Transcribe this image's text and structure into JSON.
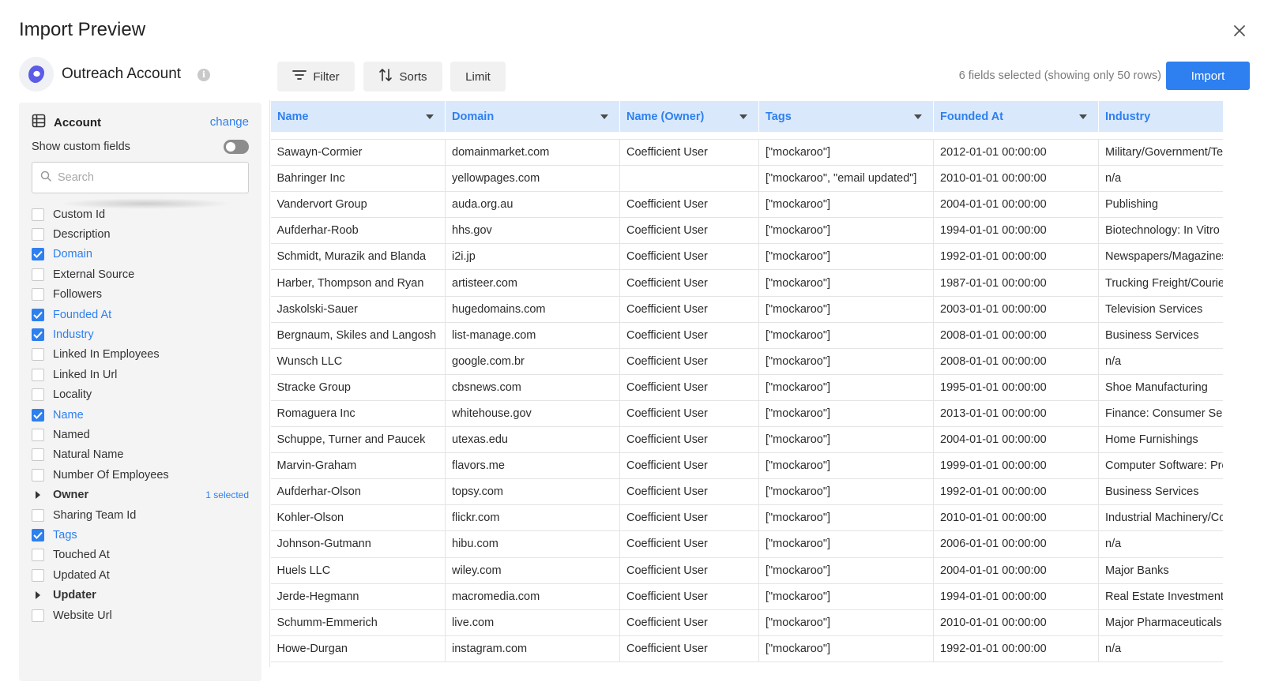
{
  "header": {
    "title": "Import Preview"
  },
  "source": {
    "name": "Outreach Account",
    "info_icon": "i"
  },
  "toolbar": {
    "filter_label": "Filter",
    "sorts_label": "Sorts",
    "limit_label": "Limit",
    "status": "6 fields selected (showing only 50 rows)",
    "import_label": "Import"
  },
  "panel": {
    "object_label": "Account",
    "change_label": "change",
    "custom_fields_label": "Show custom fields",
    "search_placeholder": "Search",
    "fields": [
      {
        "label": "Custom Id",
        "checked": false
      },
      {
        "label": "Description",
        "checked": false
      },
      {
        "label": "Domain",
        "checked": true
      },
      {
        "label": "External Source",
        "checked": false
      },
      {
        "label": "Followers",
        "checked": false
      },
      {
        "label": "Founded At",
        "checked": true
      },
      {
        "label": "Industry",
        "checked": true
      },
      {
        "label": "Linked In Employees",
        "checked": false
      },
      {
        "label": "Linked In Url",
        "checked": false
      },
      {
        "label": "Locality",
        "checked": false
      },
      {
        "label": "Name",
        "checked": true
      },
      {
        "label": "Named",
        "checked": false
      },
      {
        "label": "Natural Name",
        "checked": false
      },
      {
        "label": "Number Of Employees",
        "checked": false
      },
      {
        "label": "Owner",
        "group": true,
        "count": "1 selected"
      },
      {
        "label": "Sharing Team Id",
        "checked": false
      },
      {
        "label": "Tags",
        "checked": true
      },
      {
        "label": "Touched At",
        "checked": false
      },
      {
        "label": "Updated At",
        "checked": false
      },
      {
        "label": "Updater",
        "group": true,
        "count": ""
      },
      {
        "label": "Website Url",
        "checked": false
      }
    ]
  },
  "table": {
    "columns": [
      "Name",
      "Domain",
      "Name (Owner)",
      "Tags",
      "Founded At",
      "Industry"
    ],
    "rows": [
      [
        "Sawayn-Cormier",
        "domainmarket.com",
        "Coefficient User",
        "[\"mockaroo\"]",
        "2012-01-01 00:00:00",
        "Military/Government/Technical"
      ],
      [
        "Bahringer Inc",
        "yellowpages.com",
        "",
        "[\"mockaroo\", \"email updated\"]",
        "2010-01-01 00:00:00",
        "n/a"
      ],
      [
        "Vandervort Group",
        "auda.org.au",
        "Coefficient User",
        "[\"mockaroo\"]",
        "2004-01-01 00:00:00",
        "Publishing"
      ],
      [
        "Aufderhar-Roob",
        "hhs.gov",
        "Coefficient User",
        "[\"mockaroo\"]",
        "1994-01-01 00:00:00",
        "Biotechnology: In Vitro"
      ],
      [
        "Schmidt, Murazik and Blanda",
        "i2i.jp",
        "Coefficient User",
        "[\"mockaroo\"]",
        "1992-01-01 00:00:00",
        "Newspapers/Magazines"
      ],
      [
        "Harber, Thompson and Ryan",
        "artisteer.com",
        "Coefficient User",
        "[\"mockaroo\"]",
        "1987-01-01 00:00:00",
        "Trucking Freight/Courier"
      ],
      [
        "Jaskolski-Sauer",
        "hugedomains.com",
        "Coefficient User",
        "[\"mockaroo\"]",
        "2003-01-01 00:00:00",
        "Television Services"
      ],
      [
        "Bergnaum, Skiles and Langosh",
        "list-manage.com",
        "Coefficient User",
        "[\"mockaroo\"]",
        "2008-01-01 00:00:00",
        "Business Services"
      ],
      [
        "Wunsch LLC",
        "google.com.br",
        "Coefficient User",
        "[\"mockaroo\"]",
        "2008-01-01 00:00:00",
        "n/a"
      ],
      [
        "Stracke Group",
        "cbsnews.com",
        "Coefficient User",
        "[\"mockaroo\"]",
        "1995-01-01 00:00:00",
        "Shoe Manufacturing"
      ],
      [
        "Romaguera Inc",
        "whitehouse.gov",
        "Coefficient User",
        "[\"mockaroo\"]",
        "2013-01-01 00:00:00",
        "Finance: Consumer Services"
      ],
      [
        "Schuppe, Turner and Paucek",
        "utexas.edu",
        "Coefficient User",
        "[\"mockaroo\"]",
        "2004-01-01 00:00:00",
        "Home Furnishings"
      ],
      [
        "Marvin-Graham",
        "flavors.me",
        "Coefficient User",
        "[\"mockaroo\"]",
        "1999-01-01 00:00:00",
        "Computer Software: Prepackaged"
      ],
      [
        "Aufderhar-Olson",
        "topsy.com",
        "Coefficient User",
        "[\"mockaroo\"]",
        "1992-01-01 00:00:00",
        "Business Services"
      ],
      [
        "Kohler-Olson",
        "flickr.com",
        "Coefficient User",
        "[\"mockaroo\"]",
        "2010-01-01 00:00:00",
        "Industrial Machinery/Components"
      ],
      [
        "Johnson-Gutmann",
        "hibu.com",
        "Coefficient User",
        "[\"mockaroo\"]",
        "2006-01-01 00:00:00",
        "n/a"
      ],
      [
        "Huels LLC",
        "wiley.com",
        "Coefficient User",
        "[\"mockaroo\"]",
        "2004-01-01 00:00:00",
        "Major Banks"
      ],
      [
        "Jerde-Hegmann",
        "macromedia.com",
        "Coefficient User",
        "[\"mockaroo\"]",
        "1994-01-01 00:00:00",
        "Real Estate Investment Trusts"
      ],
      [
        "Schumm-Emmerich",
        "live.com",
        "Coefficient User",
        "[\"mockaroo\"]",
        "2010-01-01 00:00:00",
        "Major Pharmaceuticals"
      ],
      [
        "Howe-Durgan",
        "instagram.com",
        "Coefficient User",
        "[\"mockaroo\"]",
        "1992-01-01 00:00:00",
        "n/a"
      ]
    ]
  },
  "colors": {
    "accent": "#2e7ff0",
    "header_bg": "#d9e9fb",
    "logo": "#5b5be8"
  }
}
